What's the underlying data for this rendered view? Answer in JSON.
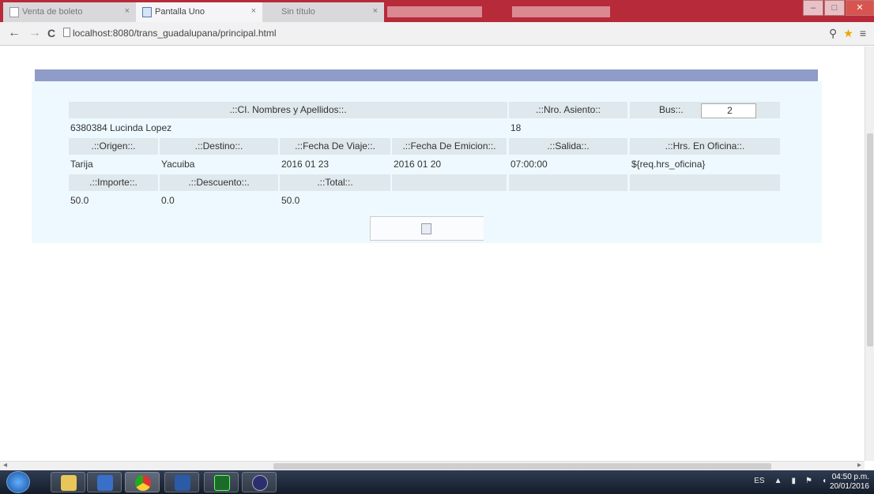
{
  "browser": {
    "tabs": [
      {
        "label": "Venta de boleto",
        "close": "×"
      },
      {
        "label": "Pantalla Uno",
        "close": "×"
      },
      {
        "label": "Sin título",
        "close": "×"
      }
    ],
    "window_buttons": {
      "minimize": "–",
      "maximize": "□",
      "close": "✕"
    },
    "nav": {
      "back": "←",
      "forward": "→",
      "reload": "C"
    },
    "url": "localhost:8080/trans_guadalupana/principal.html"
  },
  "ticket": {
    "headers_row1": {
      "name": ".::CI. Nombres y Apellidos::.",
      "seat": ".::Nro. Asiento::",
      "bus": "Bus::."
    },
    "bus_value": "2",
    "name_value": "6380384 Lucinda Lopez",
    "seat_value": "18",
    "headers_row2": [
      ".::Origen::.",
      ".::Destino::.",
      ".::Fecha De Viaje::.",
      ".::Fecha De Emicion::.",
      ".::Salida::.",
      ".::Hrs. En Oficina::."
    ],
    "values_row2": [
      "Tarija",
      "Yacuiba",
      "2016 01 23",
      "2016 01 20",
      "07:00:00",
      "${req.hrs_oficina}"
    ],
    "headers_row3": [
      ".::Importe::.",
      ".::Descuento::.",
      ".::Total::."
    ],
    "values_row3": [
      "50.0",
      "0.0",
      "50.0"
    ]
  },
  "taskbar": {
    "tray": {
      "lang": "ES"
    },
    "clock": {
      "time": "04:50 p.m.",
      "date": "20/01/2016"
    }
  }
}
